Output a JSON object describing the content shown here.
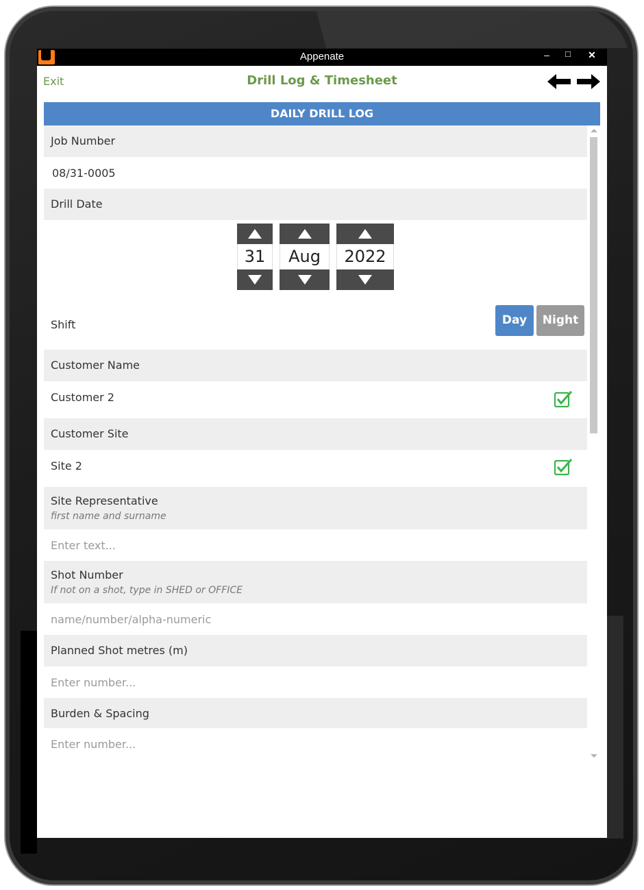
{
  "window": {
    "title": "Appenate",
    "minimize": "–",
    "maximize": "□",
    "close": "✕"
  },
  "nav": {
    "exit_label": "Exit",
    "title": "Drill Log & Timesheet",
    "back_icon": "arrow-left-icon",
    "forward_icon": "arrow-right-icon"
  },
  "section": {
    "title": "DAILY DRILL LOG"
  },
  "fields": {
    "job_number": {
      "label": "Job Number",
      "value": "08/31-0005"
    },
    "drill_date": {
      "label": "Drill Date",
      "day": "31",
      "month": "Aug",
      "year": "2022"
    },
    "shift": {
      "label": "Shift",
      "options": [
        "Day",
        "Night"
      ],
      "selected": "Day"
    },
    "customer_name": {
      "label": "Customer Name",
      "value": "Customer 2"
    },
    "customer_site": {
      "label": "Customer Site",
      "value": "Site 2"
    },
    "site_representative": {
      "label": "Site Representative",
      "hint": "first name and surname",
      "placeholder": "Enter text..."
    },
    "shot_number": {
      "label": "Shot Number",
      "hint": "If not on a shot, type in SHED or OFFICE",
      "placeholder": "name/number/alpha-numeric"
    },
    "planned_shot_metres": {
      "label": "Planned Shot metres (m)",
      "placeholder": "Enter number..."
    },
    "burden_spacing": {
      "label": "Burden & Spacing",
      "placeholder": "Enter number..."
    }
  },
  "colors": {
    "accent_blue": "#4e86c8",
    "title_green": "#6b9a4a",
    "check_green": "#3cb44b",
    "button_gray": "#9a9a9a"
  }
}
